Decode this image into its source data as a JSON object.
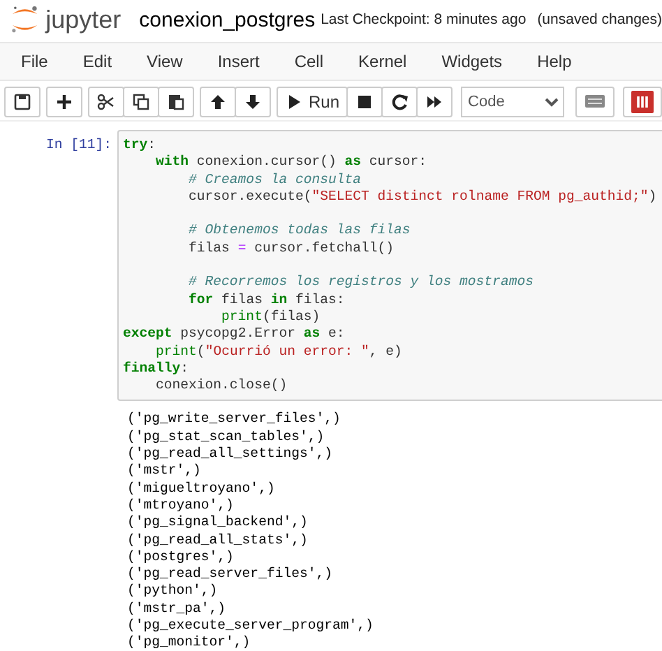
{
  "header": {
    "logo_text": "jupyter",
    "notebook_title": "conexion_postgres",
    "checkpoint": "Last Checkpoint: 8 minutes ago",
    "status": "(unsaved changes)"
  },
  "menu": [
    "File",
    "Edit",
    "View",
    "Insert",
    "Cell",
    "Kernel",
    "Widgets",
    "Help"
  ],
  "toolbar": {
    "groups": [
      {
        "buttons": [
          {
            "kind": "save"
          }
        ]
      },
      {
        "buttons": [
          {
            "kind": "add"
          }
        ]
      },
      {
        "buttons": [
          {
            "kind": "cut"
          },
          {
            "kind": "copy"
          },
          {
            "kind": "paste"
          }
        ]
      },
      {
        "buttons": [
          {
            "kind": "up"
          },
          {
            "kind": "down"
          }
        ]
      },
      {
        "buttons": [
          {
            "kind": "run",
            "label": "Run"
          },
          {
            "kind": "stop"
          },
          {
            "kind": "restart"
          },
          {
            "kind": "fastforward"
          }
        ]
      }
    ],
    "cell_type": "Code",
    "extra": [
      {
        "kind": "keyboard"
      },
      {
        "kind": "columns"
      }
    ]
  },
  "cell": {
    "prompt": "In [11]:",
    "lines": [
      {
        "kind": "code",
        "tokens": [
          {
            "kind": "kw",
            "text": "try"
          },
          {
            "kind": "text",
            "text": ":"
          }
        ]
      },
      {
        "kind": "code",
        "tokens": [
          {
            "kind": "kw",
            "text": "    with"
          },
          {
            "kind": "text",
            "text": " conexion.cursor() "
          },
          {
            "kind": "kw",
            "text": "as"
          },
          {
            "kind": "text",
            "text": " cursor:"
          }
        ]
      },
      {
        "kind": "code",
        "tokens": [
          {
            "kind": "comment",
            "text": "        # Creamos la consulta"
          }
        ]
      },
      {
        "kind": "code",
        "tokens": [
          {
            "kind": "text",
            "text": "        cursor.execute("
          },
          {
            "kind": "string",
            "text": "\"SELECT distinct rolname FROM pg_authid;\""
          },
          {
            "kind": "text",
            "text": ")"
          }
        ]
      },
      {
        "kind": "blank"
      },
      {
        "kind": "code",
        "tokens": [
          {
            "kind": "comment",
            "text": "        # Obtenemos todas las filas"
          }
        ]
      },
      {
        "kind": "code",
        "tokens": [
          {
            "kind": "text",
            "text": "        filas "
          },
          {
            "kind": "op",
            "text": "="
          },
          {
            "kind": "text",
            "text": " cursor.fetchall()"
          }
        ]
      },
      {
        "kind": "blank"
      },
      {
        "kind": "code",
        "tokens": [
          {
            "kind": "comment",
            "text": "        # Recorremos los registros y los mostramos"
          }
        ]
      },
      {
        "kind": "code",
        "tokens": [
          {
            "kind": "kw",
            "text": "        for"
          },
          {
            "kind": "text",
            "text": " filas "
          },
          {
            "kind": "kw",
            "text": "in"
          },
          {
            "kind": "text",
            "text": " filas:"
          }
        ]
      },
      {
        "kind": "code",
        "tokens": [
          {
            "kind": "builtin",
            "text": "            print"
          },
          {
            "kind": "text",
            "text": "(filas)"
          }
        ]
      },
      {
        "kind": "code",
        "tokens": [
          {
            "kind": "kw",
            "text": "except"
          },
          {
            "kind": "text",
            "text": " psycopg2.Error "
          },
          {
            "kind": "kw",
            "text": "as"
          },
          {
            "kind": "text",
            "text": " e:"
          }
        ]
      },
      {
        "kind": "code",
        "tokens": [
          {
            "kind": "builtin",
            "text": "    print"
          },
          {
            "kind": "text",
            "text": "("
          },
          {
            "kind": "string",
            "text": "\"Ocurrió un error: \""
          },
          {
            "kind": "text",
            "text": ", e)"
          }
        ]
      },
      {
        "kind": "code",
        "tokens": [
          {
            "kind": "kw",
            "text": "finally"
          },
          {
            "kind": "text",
            "text": ":"
          }
        ]
      },
      {
        "kind": "code",
        "tokens": [
          {
            "kind": "text",
            "text": "    conexion.close()"
          }
        ]
      }
    ]
  },
  "output": [
    "('pg_write_server_files',)",
    "('pg_stat_scan_tables',)",
    "('pg_read_all_settings',)",
    "('mstr',)",
    "('migueltroyano',)",
    "('mtroyano',)",
    "('pg_signal_backend',)",
    "('pg_read_all_stats',)",
    "('postgres',)",
    "('pg_read_server_files',)",
    "('python',)",
    "('mstr_pa',)",
    "('pg_execute_server_program',)",
    "('pg_monitor',)"
  ]
}
